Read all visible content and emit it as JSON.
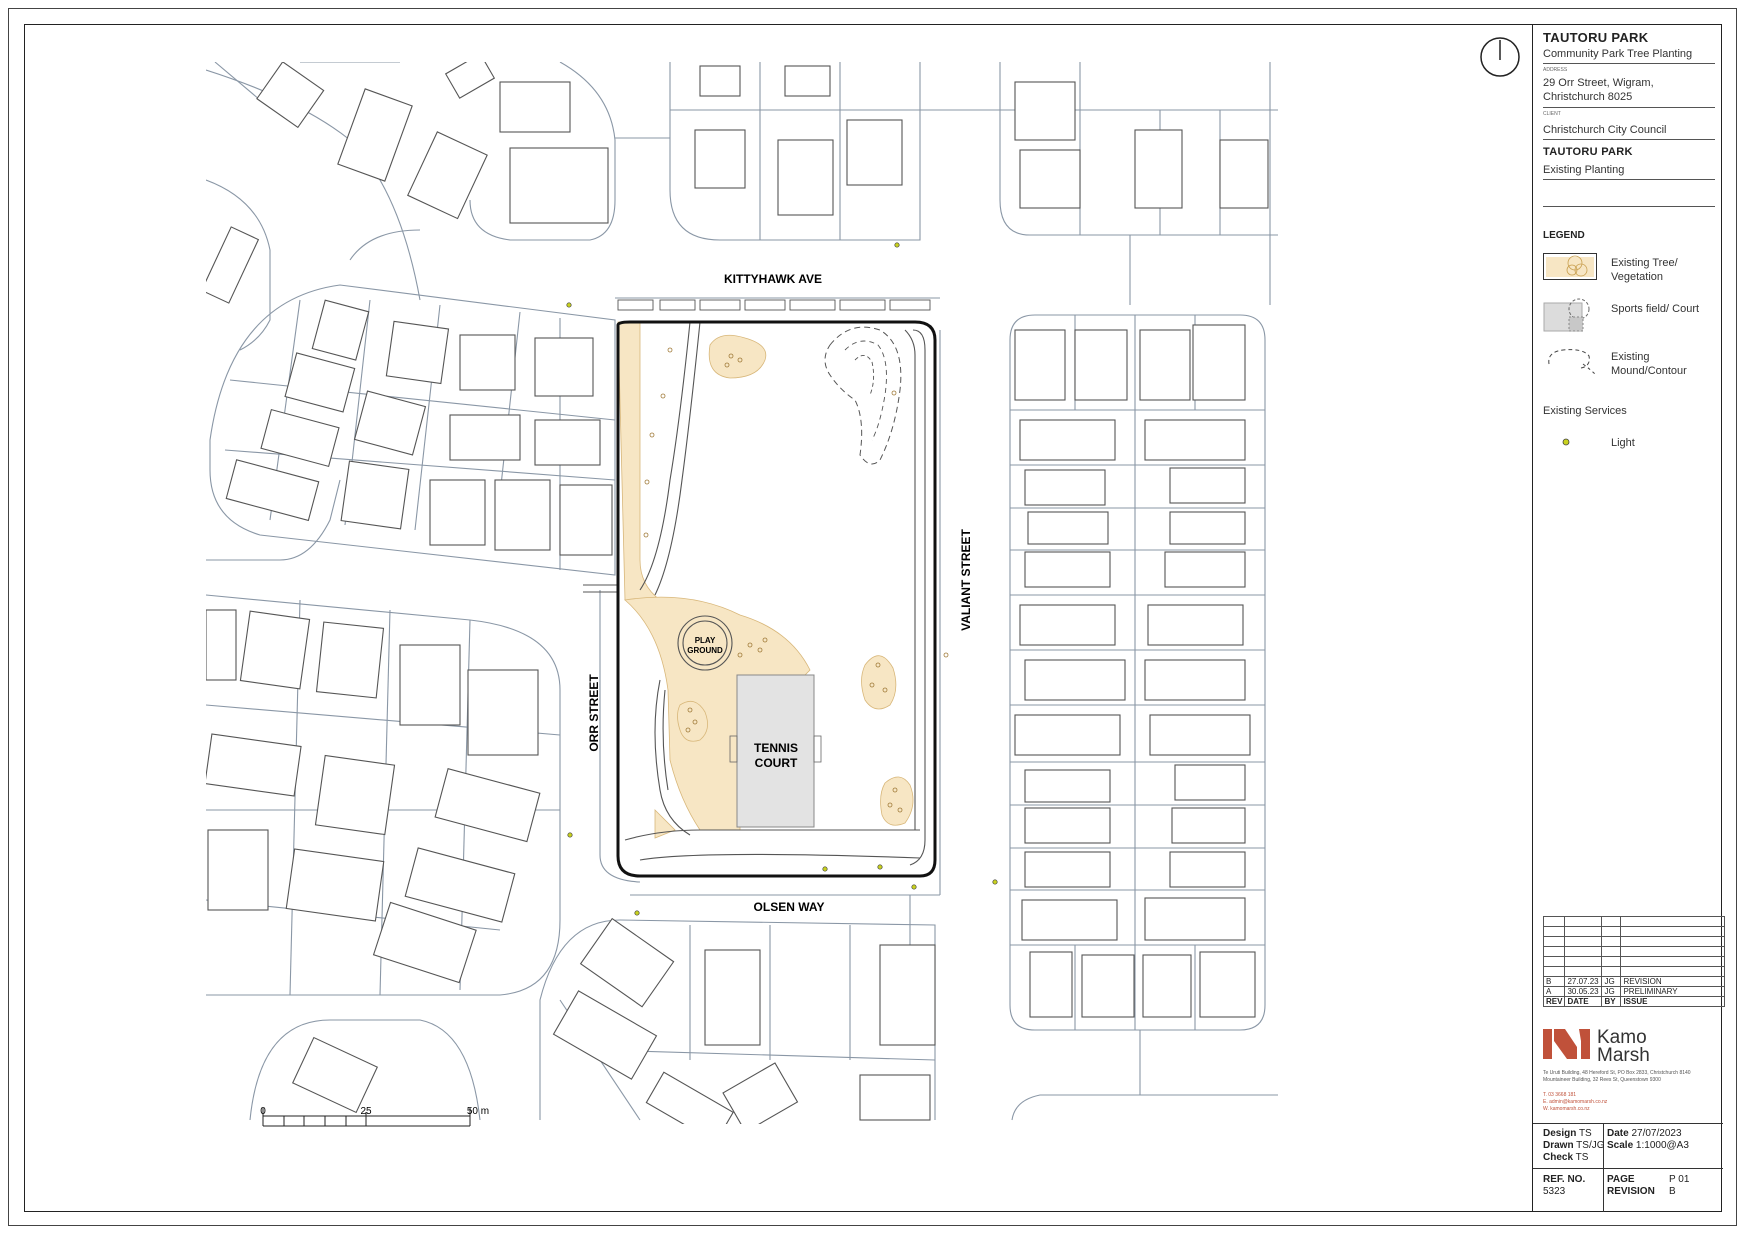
{
  "title_block": {
    "project": "TAUTORU PARK",
    "project_sub": "Community Park Tree Planting",
    "address_label": "ADDRESS",
    "address_line1": "29 Orr Street, Wigram,",
    "address_line2": "Christchurch 8025",
    "client_label": "CLIENT",
    "client": "Christchurch City Council",
    "sheet_title": "TAUTORU PARK",
    "sheet_sub": "Existing Planting"
  },
  "legend": {
    "heading": "LEGEND",
    "items": [
      {
        "label_1": "Existing Tree/",
        "label_2": "Vegetation",
        "icon": "tree-vegetation-swatch"
      },
      {
        "label_1": "Sports field/ Court",
        "label_2": "",
        "icon": "sports-court-swatch"
      },
      {
        "label_1": "Existing",
        "label_2": "Mound/Contour",
        "icon": "mound-contour-swatch"
      }
    ],
    "services_heading": "Existing Services",
    "light_label": "Light"
  },
  "revisions": {
    "rows": [
      {
        "rev": "B",
        "date": "27.07.23",
        "by": "JG",
        "issue": "REVISION"
      },
      {
        "rev": "A",
        "date": "30.05.23",
        "by": "JG",
        "issue": "PRELIMINARY"
      }
    ],
    "header": {
      "rev": "REV",
      "date": "DATE",
      "by": "BY",
      "issue": "ISSUE"
    }
  },
  "company": {
    "name_1": "Kamo",
    "name_2": "Marsh",
    "address_1": "Te Uruti Building, 48 Hereford St, PO Box 2833, Christchurch 8140",
    "address_2": "Mountaineer Building, 32 Rees St, Queenstown 9300",
    "phone": "T. 03 3668 181",
    "email": "E. admin@kamomarsh.co.nz",
    "web": "W. kamomarsh.co.nz",
    "brand_color": "#c0513a"
  },
  "meta": {
    "design_label": "Design",
    "design": "TS",
    "drawn_label": "Drawn",
    "drawn": "TS/JG",
    "check_label": "Check",
    "check": "TS",
    "date_label": "Date",
    "date": "27/07/2023",
    "scale_label": "Scale",
    "scale": "1:1000@A3",
    "ref_label": "REF. NO.",
    "ref": "5323",
    "page_label": "PAGE",
    "page": "P 01",
    "revision_label": "REVISION",
    "revision": "B"
  },
  "map": {
    "streets": {
      "kittyhawk": "KITTYHAWK AVE",
      "valiant": "VALIANT STREET",
      "orr": "ORR STREET",
      "olsen": "OLSEN WAY"
    },
    "features": {
      "playground_1": "PLAY",
      "playground_2": "GROUND",
      "tennis_1": "TENNIS",
      "tennis_2": "COURT"
    },
    "scale_bar": {
      "zero": "0",
      "mid": "25",
      "end": "50 m"
    },
    "colors": {
      "vegetation": "#f7e6c4",
      "vegetation_stroke": "#d8b77a",
      "court": "#e3e3e3",
      "lot_line": "#8a97a6",
      "building": "#555555",
      "light": "#c9d21e",
      "boundary": "#111111"
    }
  }
}
